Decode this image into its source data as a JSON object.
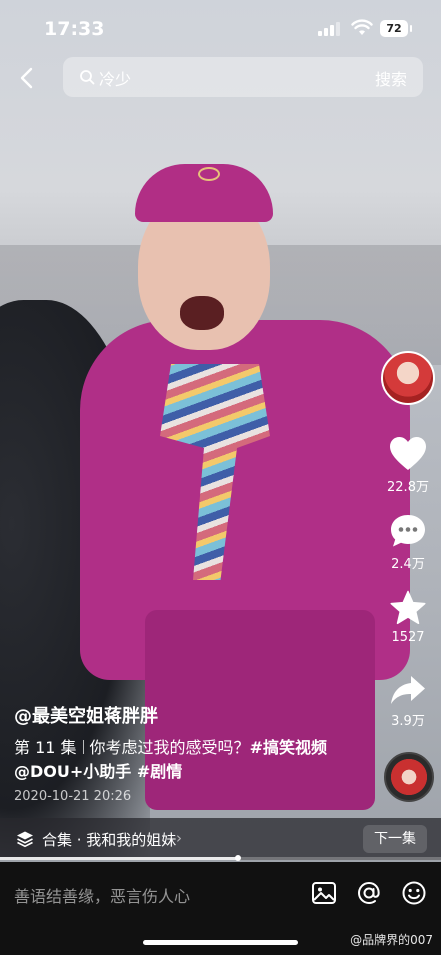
{
  "status_bar": {
    "time": "17:33",
    "battery": "72"
  },
  "search": {
    "query": "冷少",
    "button": "搜索"
  },
  "right_rail": {
    "likes": "22.8万",
    "comments": "2.4万",
    "favorites": "1527",
    "shares": "3.9万"
  },
  "caption": {
    "author": "@最美空姐蒋胖胖",
    "episode": "第 11 集",
    "title": "你考虑过我的感受吗？",
    "tags": "#搞笑视频 @DOU+小助手 #剧情",
    "date": "2020-10-21 20:26"
  },
  "collection": {
    "label": "合集 · 我和我的姐妹",
    "next": "下一集",
    "progress": 0.54
  },
  "comment_bar": {
    "placeholder": "善语结善缘，恶言伤人心"
  },
  "watermark": "@品牌界的007"
}
